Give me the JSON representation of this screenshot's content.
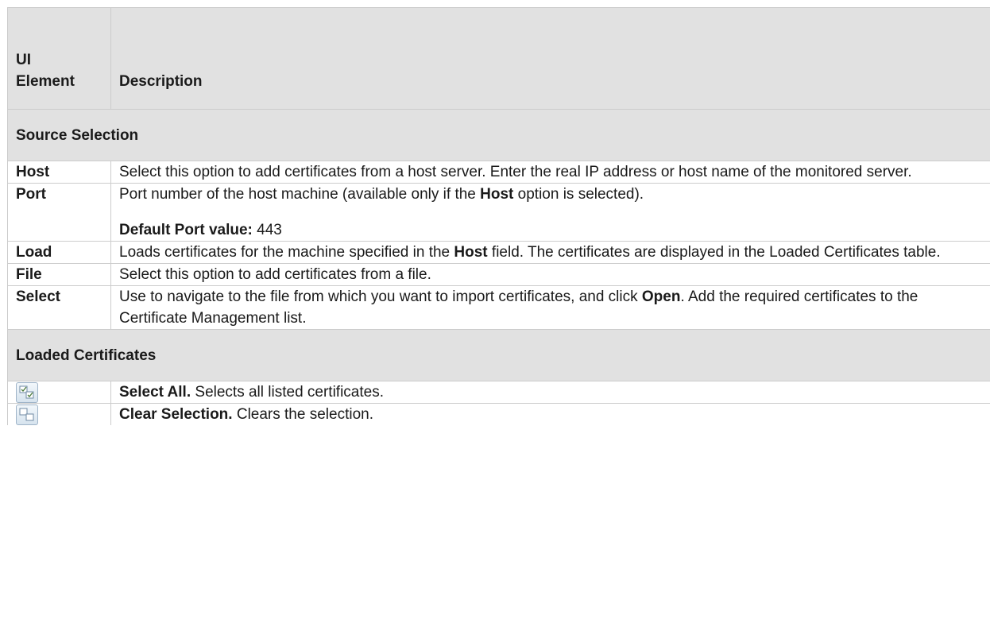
{
  "header": {
    "ui_element_line1": "UI",
    "ui_element_line2": "Element",
    "description": "Description"
  },
  "sections": {
    "source_selection": "Source Selection",
    "loaded_certificates": "Loaded Certificates"
  },
  "rows": {
    "host": {
      "element": "Host",
      "text": "Select this option to add certificates from a host server. Enter the real IP address or host name of the monitored server."
    },
    "port": {
      "element": "Port",
      "text_a": "Port number of the host machine (available only if the ",
      "bold": "Host",
      "text_b": " option is selected).",
      "default_label": "Default Port value:",
      "default_value": " 443"
    },
    "load": {
      "element": "Load",
      "text_a": "Loads certificates for the machine specified in the ",
      "bold": "Host",
      "text_b": " field. The certificates are displayed in the Loaded Certificates table."
    },
    "file": {
      "element": "File",
      "text": "Select this option to add certificates from a file."
    },
    "select": {
      "element": "Select",
      "text_a": "Use to navigate to the file from which you want to import certificates, and click ",
      "bold": "Open",
      "text_b": ". Add the required certificates to the Certificate Management list."
    },
    "select_all": {
      "icon": "select-all-icon",
      "bold": "Select All.",
      "text": " Selects all listed certificates."
    },
    "clear_selection": {
      "icon": "clear-selection-icon",
      "bold": "Clear Selection.",
      "text": " Clears the selection."
    }
  },
  "colors": {
    "header_bg": "#e1e1e1",
    "border": "#cccccc",
    "icon_border": "#9fb4c8"
  }
}
